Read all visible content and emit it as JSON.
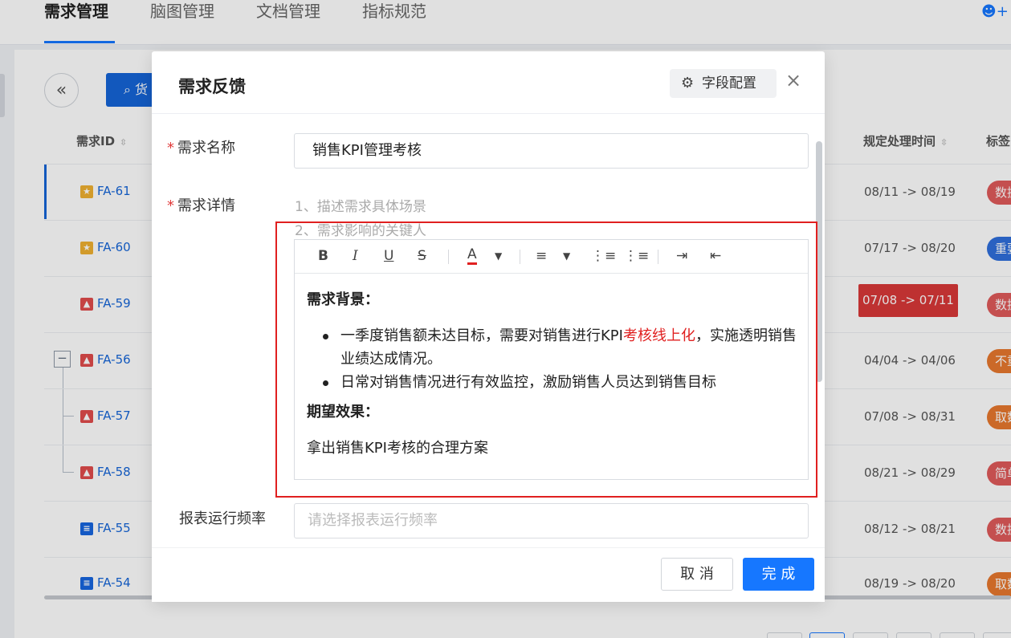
{
  "nav": {
    "tabs": [
      "需求管理",
      "脑图管理",
      "文档管理",
      "指标规范"
    ],
    "active_tab": "需求管理"
  },
  "list": {
    "search_label": "⌕ 货",
    "columns": {
      "id": "需求ID",
      "deadline": "规定处理时间",
      "tags": "标签"
    },
    "rows": [
      {
        "icon": "star-icon",
        "id": "FA-61",
        "date": "08/11 -> 08/19",
        "tag": "数据",
        "tag_color": "#e05a5a"
      },
      {
        "icon": "star-icon",
        "id": "FA-60",
        "date": "07/17 -> 08/20",
        "tag": "重要",
        "tag_color": "#2f6fdc"
      },
      {
        "icon": "alert-icon",
        "id": "FA-59",
        "date": "07/08 -> 07/11",
        "tag": "数据",
        "tag_color": "#e05a5a"
      },
      {
        "icon": "alert-icon",
        "id": "FA-56",
        "date": "04/04 -> 04/06",
        "tag": "不重要",
        "tag_color": "#e8782e"
      },
      {
        "icon": "alert-icon",
        "id": "FA-57",
        "date": "07/08 -> 08/31",
        "tag": "取数",
        "tag_color": "#e8782e"
      },
      {
        "icon": "alert-icon",
        "id": "FA-58",
        "date": "08/21 -> 08/29",
        "tag": "简单",
        "tag_color": "#e05a5a"
      },
      {
        "icon": "doc-icon",
        "id": "FA-55",
        "date": "08/12 -> 08/21",
        "tag": "数据",
        "tag_color": "#e05a5a"
      },
      {
        "icon": "doc-icon",
        "id": "FA-54",
        "date": "08/19 -> 08/20",
        "tag": "取数",
        "tag_color": "#e8782e"
      }
    ]
  },
  "modal": {
    "title": "需求反馈",
    "config_button": "字段配置",
    "close": "×",
    "fields": {
      "name_label": "需求名称",
      "name_value": "销售KPI管理考核",
      "detail_label": "需求详情",
      "detail_placeholder_1": "1、描述需求具体场景",
      "detail_placeholder_2": "2、需求影响的关键人",
      "frequency_label": "报表运行频率",
      "frequency_placeholder": "请选择报表运行频率"
    },
    "editor": {
      "heading_1": "需求背景：",
      "bullet_1_part1": "一季度销售额未达目标，需要对销售进行KPI",
      "bullet_1_highlight": "考核线上化",
      "bullet_1_part2": "，实施透明销售业绩达成情况。",
      "bullet_2": "日常对销售情况进行有效监控，激励销售人员达到销售目标",
      "heading_2": "期望效果：",
      "paragraph": "拿出销售KPI考核的合理方案"
    },
    "footer": {
      "cancel": "取 消",
      "confirm": "完 成"
    }
  },
  "colors": {
    "primary": "#1677ff",
    "highlight_red": "#e02020"
  }
}
